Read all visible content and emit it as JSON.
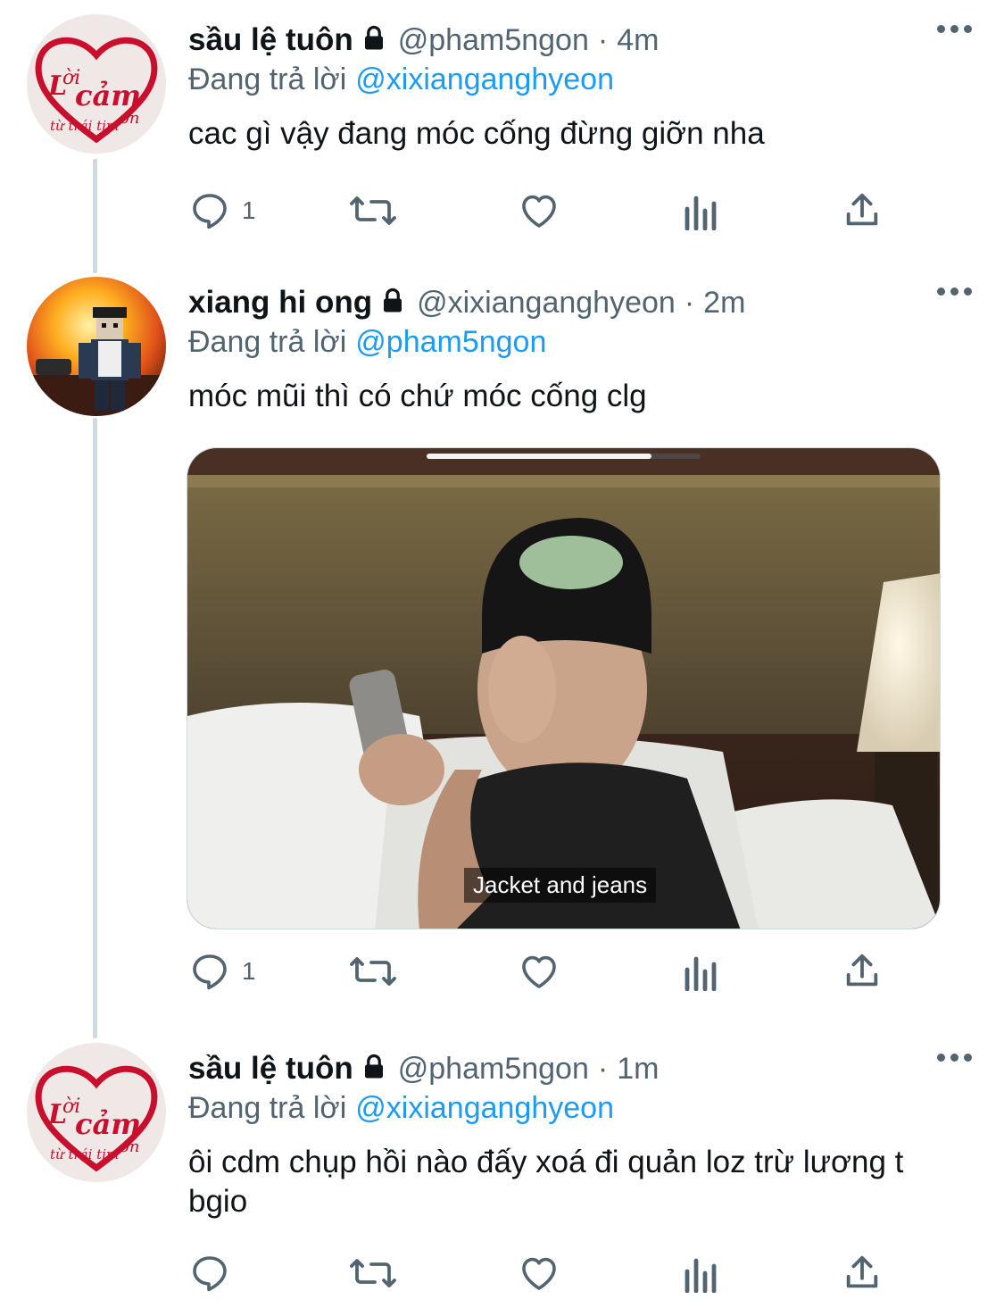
{
  "tweets": [
    {
      "name": "sầu lệ tuôn",
      "handle": "@pham5ngon",
      "sep": "·",
      "time": "4m",
      "reply_prefix": "Đang trả lời",
      "reply_to": "@xixianganghyeon",
      "text": "cac gì vậy đang móc cống đừng giỡn nha",
      "reply_count": "1",
      "avatar_text": [
        "Lời",
        "cảm",
        "ơn",
        "từ trái tim"
      ]
    },
    {
      "name": "xiang hi ong",
      "handle": "@xixianganghyeon",
      "sep": "·",
      "time": "2m",
      "reply_prefix": "Đang trả lời",
      "reply_to": "@pham5ngon",
      "text": "móc mũi thì có chứ móc cống clg",
      "reply_count": "1",
      "media": {
        "caption": "Jacket and jeans",
        "progress": 0.82
      }
    },
    {
      "name": "sầu lệ tuôn",
      "handle": "@pham5ngon",
      "sep": "·",
      "time": "1m",
      "reply_prefix": "Đang trả lời",
      "reply_to": "@xixianganghyeon",
      "text": "ôi cdm chụp hồi nào đấy xoá đi quản loz trừ lương t bgio",
      "reply_count": "",
      "avatar_text": [
        "Lời",
        "cảm",
        "ơn",
        "từ trái tim"
      ]
    }
  ],
  "icons": {
    "reply": "reply-icon",
    "retweet": "retweet-icon",
    "like": "heart-icon",
    "views": "views-icon",
    "share": "share-icon",
    "lock": "lock-icon",
    "more": "more-icon"
  },
  "colors": {
    "text": "#0f1419",
    "secondary": "#536471",
    "accent": "#1d9bf0",
    "thread_line": "#cfd9de",
    "avatar_heart": "#c8102e"
  }
}
